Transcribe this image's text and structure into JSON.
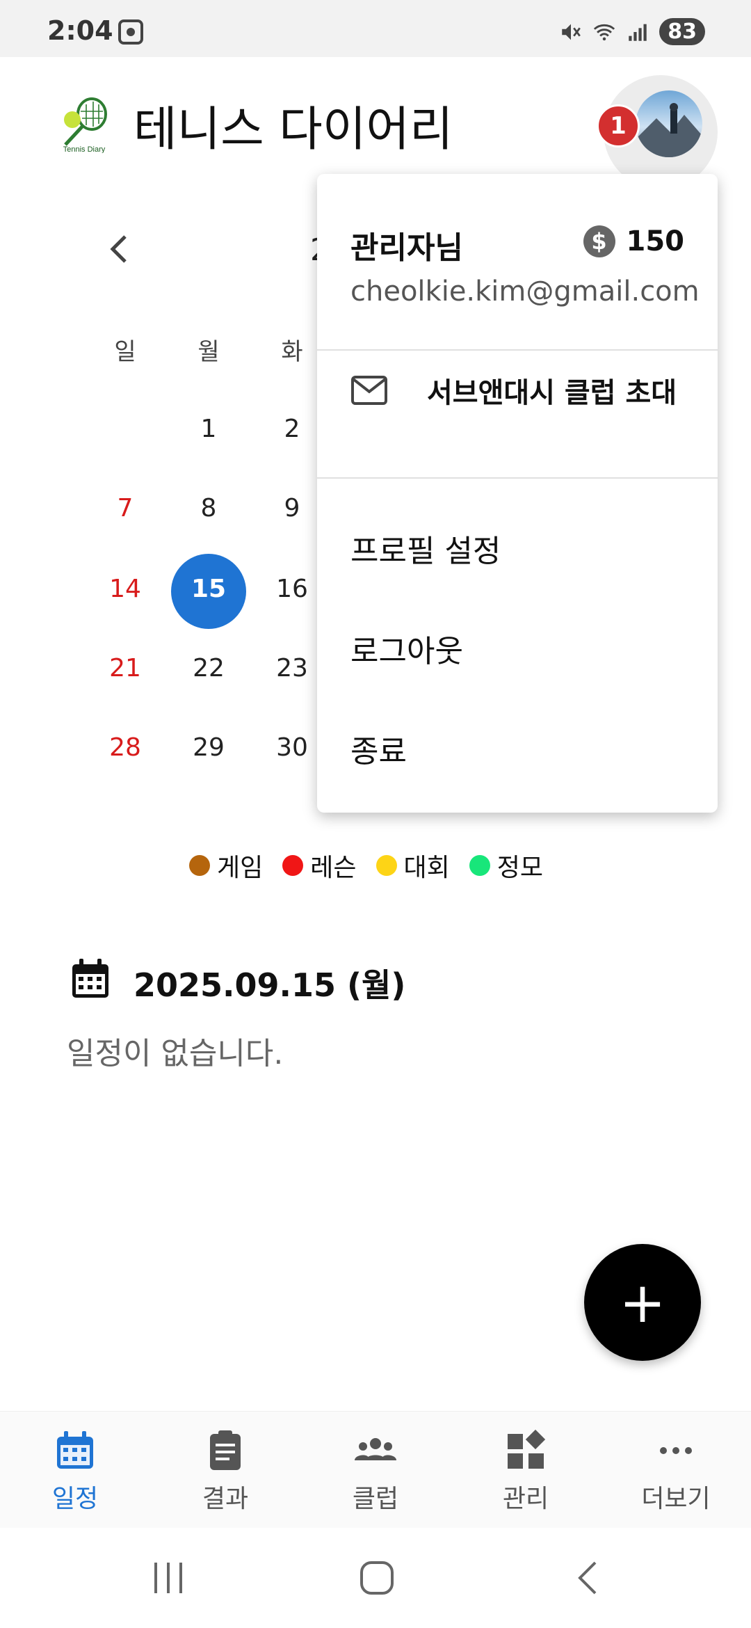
{
  "status_bar": {
    "time": "2:04",
    "battery": "83"
  },
  "app": {
    "title": "테니스 다이어리",
    "logo_text": "Tennis Diary",
    "notification_count": "1"
  },
  "calendar": {
    "month_partial": "2",
    "weekdays": [
      "일",
      "월",
      "화"
    ],
    "rows": [
      [
        "",
        "1",
        "2"
      ],
      [
        "7",
        "8",
        "9"
      ],
      [
        "14",
        "15",
        "16"
      ],
      [
        "21",
        "22",
        "23"
      ],
      [
        "28",
        "29",
        "30"
      ]
    ],
    "today": "15"
  },
  "legend": [
    {
      "label": "게임",
      "color": "#b5650d"
    },
    {
      "label": "레슨",
      "color": "#f01616"
    },
    {
      "label": "대회",
      "color": "#fdd416"
    },
    {
      "label": "정모",
      "color": "#18e67a"
    }
  ],
  "selected": {
    "date": "2025.09.15 (월)",
    "empty_message": "일정이 없습니다."
  },
  "fab": {
    "label": "+"
  },
  "bottom_nav": [
    {
      "label": "일정",
      "icon": "calendar-icon",
      "active": true
    },
    {
      "label": "결과",
      "icon": "clipboard-icon",
      "active": false
    },
    {
      "label": "클럽",
      "icon": "group-icon",
      "active": false
    },
    {
      "label": "관리",
      "icon": "widgets-icon",
      "active": false
    },
    {
      "label": "더보기",
      "icon": "more-icon",
      "active": false
    }
  ],
  "menu": {
    "user_name": "관리자님",
    "coins": "150",
    "email": "cheolkie.kim@gmail.com",
    "invite": "서브앤대시 클럽 초대",
    "profile": "프로필 설정",
    "logout": "로그아웃",
    "exit": "종료"
  },
  "colors": {
    "primary": "#1f74d3",
    "sunday": "#d81b1b",
    "badge": "#d32f2f"
  }
}
